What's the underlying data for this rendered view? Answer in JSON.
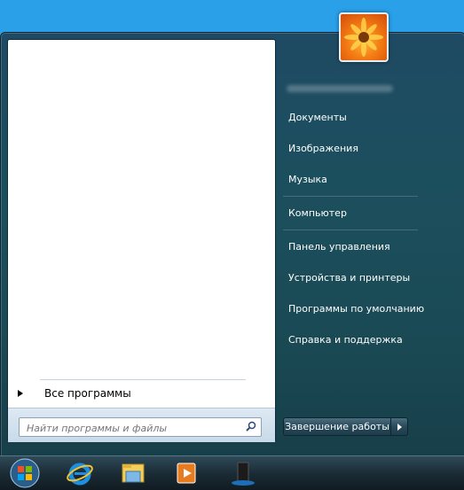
{
  "left_pane": {
    "all_programs_label": "Все программы",
    "search_placeholder": "Найти программы и файлы"
  },
  "right_pane": {
    "items": [
      {
        "label": "Документы"
      },
      {
        "label": "Изображения"
      },
      {
        "label": "Музыка"
      },
      {
        "label": "Компьютер"
      },
      {
        "label": "Панель управления"
      },
      {
        "label": "Устройства и принтеры"
      },
      {
        "label": "Программы по умолчанию"
      },
      {
        "label": "Справка и поддержка"
      }
    ],
    "shutdown_label": "Завершение работы"
  },
  "taskbar": {
    "icons": [
      "start-orb-icon",
      "internet-explorer-icon",
      "file-explorer-icon",
      "media-player-icon",
      "pc-tower-icon"
    ]
  },
  "colors": {
    "desktop": "#2aa0e8",
    "menu_dark": "#1c4f5e",
    "taskbar": "#1b2c36"
  }
}
